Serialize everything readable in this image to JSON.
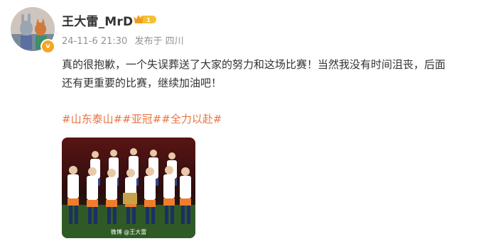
{
  "post": {
    "author_name": "王大雷_MrD",
    "vip_level": "1",
    "verified_badge": "v",
    "timestamp": "24-11-6 21:30",
    "source": "发布于 四川",
    "text_line_1": "真的很抱歉，一个失误葬送了大家的努力和这场比赛！当然我没有时间沮丧，后面",
    "text_line_2": "还有更重要的比赛，继续加油吧！",
    "hashtags": [
      "#山东泰山#",
      "#亚冠#",
      "#全力以赴#"
    ],
    "image_watermark": "微博 @王大雷"
  },
  "colors": {
    "hashtag": "#eb7340",
    "meta": "#939393",
    "badge": "#f5a623"
  },
  "icons": {
    "avatar": "avatar",
    "vip": "crown-icon",
    "verified": "verified-v-icon"
  }
}
